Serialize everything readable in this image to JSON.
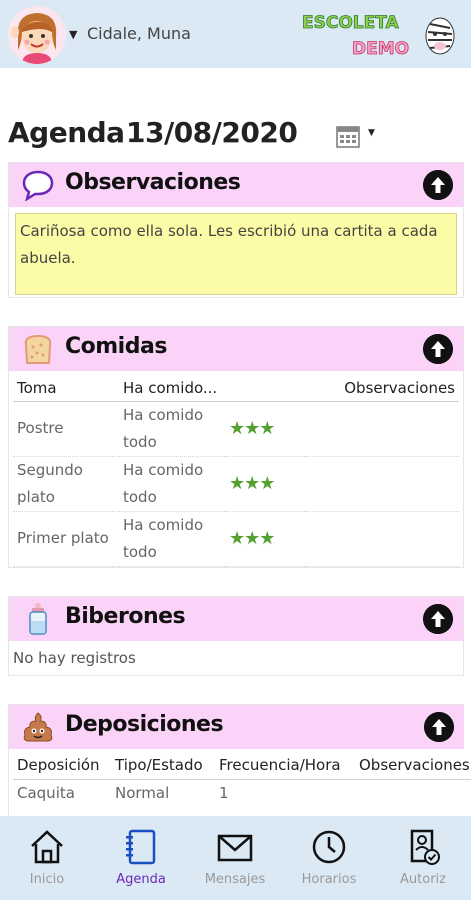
{
  "header": {
    "user_name": "Cidale, Muna",
    "logo_line1": "ESCOLETA",
    "logo_line2": "DEMO"
  },
  "agenda": {
    "title": "Agenda",
    "date": "13/08/2020"
  },
  "observaciones": {
    "title": "Observaciones",
    "text": "Cariñosa como ella sola. Les escribió una cartita a cada abuela."
  },
  "comidas": {
    "title": "Comidas",
    "columns": [
      "Toma",
      "Ha comido...",
      "",
      "Observaciones"
    ],
    "rows": [
      {
        "toma": "Postre",
        "ha_comido": "Ha comido todo",
        "stars": "★★★"
      },
      {
        "toma": "Segundo plato",
        "ha_comido": "Ha comido todo",
        "stars": "★★★"
      },
      {
        "toma": "Primer plato",
        "ha_comido": "Ha comido todo",
        "stars": "★★★"
      }
    ]
  },
  "biberones": {
    "title": "Biberones",
    "empty_text": "No hay registros"
  },
  "deposiciones": {
    "title": "Deposiciones",
    "columns": [
      "Deposición",
      "Tipo/Estado",
      "Frecuencia/Hora",
      "Observaciones"
    ],
    "rows": [
      {
        "deposicion": "Caquita",
        "tipo": "Normal",
        "frecuencia": "1",
        "observaciones": ""
      }
    ]
  },
  "bottom_nav": [
    {
      "label": "Inicio",
      "icon": "home-icon",
      "active": false
    },
    {
      "label": "Agenda",
      "icon": "notebook-icon",
      "active": true
    },
    {
      "label": "Mensajes",
      "icon": "envelope-icon",
      "active": false
    },
    {
      "label": "Horarios",
      "icon": "clock-icon",
      "active": false
    },
    {
      "label": "Autoriz",
      "icon": "authorization-icon",
      "active": false
    }
  ],
  "colors": {
    "bar_bg": "#dbe9f5",
    "section_header": "#fbd3f8",
    "note_bg": "#fdfca6",
    "active_nav": "#6a28b8",
    "stars": "#55a030"
  }
}
